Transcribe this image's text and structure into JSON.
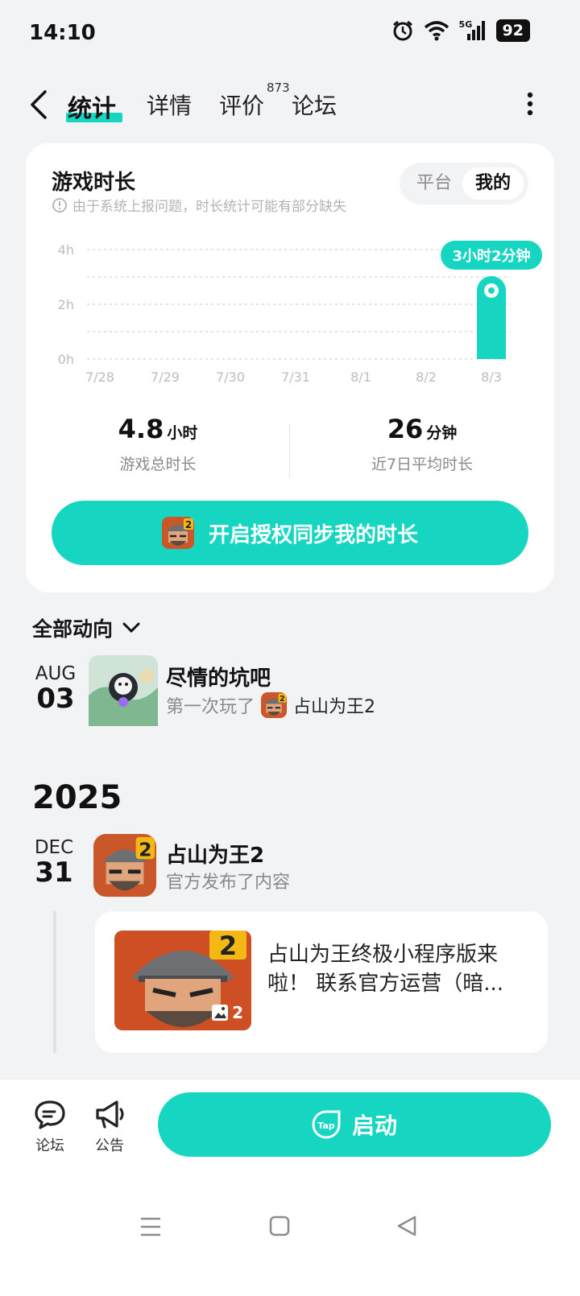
{
  "status_bar": {
    "time": "14:10",
    "network": "5G",
    "battery": "92"
  },
  "header": {
    "tabs": [
      {
        "label": "统计"
      },
      {
        "label": "详情"
      },
      {
        "label": "评价"
      },
      {
        "label": "论坛"
      }
    ],
    "review_count": "873"
  },
  "playtime_card": {
    "title": "游戏时长",
    "notice": "由于系统上报问题，时长统计可能有部分缺失",
    "segment": {
      "platform": "平台",
      "mine": "我的"
    },
    "chart_data": {
      "type": "bar",
      "categories": [
        "7/28",
        "7/29",
        "7/30",
        "7/31",
        "8/1",
        "8/2",
        "8/3"
      ],
      "values": [
        0,
        0,
        0,
        0,
        0,
        0,
        3.03
      ],
      "y_ticks": [
        "0h",
        "2h",
        "4h"
      ],
      "ylim": [
        0,
        4
      ],
      "highlight_label": "3小时2分钟",
      "grid": true,
      "bar_color": "#16d6c1"
    },
    "stats": {
      "total_value": "4.8",
      "total_unit": "小时",
      "total_label": "游戏总时长",
      "avg_value": "26",
      "avg_unit": "分钟",
      "avg_label": "近7日平均时长"
    },
    "auth_button": "开启授权同步我的时长"
  },
  "activity": {
    "section_title": "全部动向",
    "entries": [
      {
        "month": "AUG",
        "day": "03",
        "title": "尽情的坑吧",
        "sub": "第一次玩了",
        "game": "占山为王2"
      }
    ],
    "year": "2025",
    "entries_2025": [
      {
        "month": "DEC",
        "day": "31",
        "title": "占山为王2",
        "sub": "官方发布了内容",
        "post_text": "占山为王终极小程序版来啦！ 联系官方运营（暗...",
        "image_count": "2"
      }
    ]
  },
  "bottom_bar": {
    "forum": "论坛",
    "announce": "公告",
    "launch": "启动",
    "launch_logo": "Tap"
  },
  "colors": {
    "accent": "#16d6c1",
    "background": "#f1f3f5"
  }
}
